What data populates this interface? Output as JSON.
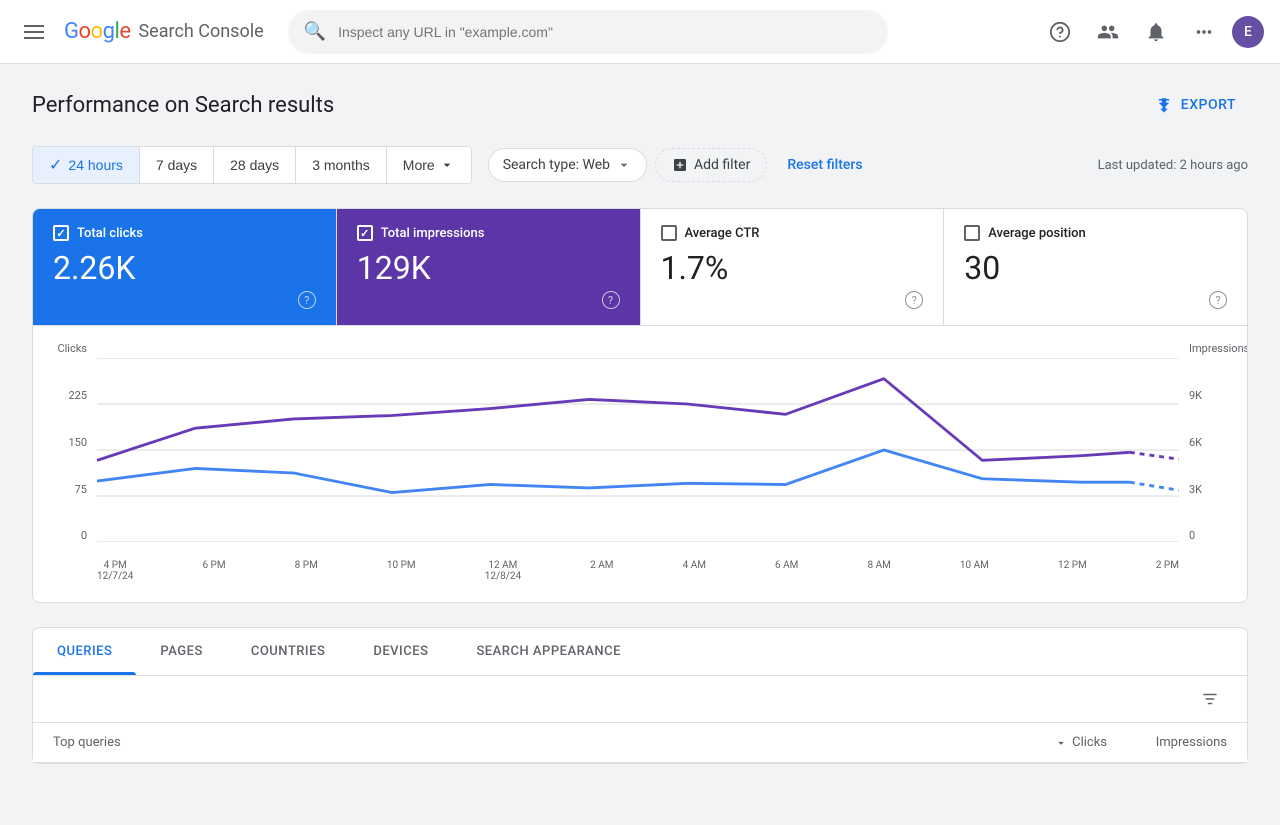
{
  "app": {
    "title": "Google Search Console",
    "logo_text": "Google",
    "product_name": "Search Console"
  },
  "nav": {
    "search_placeholder": "Inspect any URL in \"example.com\"",
    "avatar_letter": "E",
    "export_label": "EXPORT",
    "hamburger_label": "Menu"
  },
  "page": {
    "title": "Performance on Search results"
  },
  "filters": {
    "time_options": [
      {
        "label": "24 hours",
        "active": true
      },
      {
        "label": "7 days",
        "active": false
      },
      {
        "label": "28 days",
        "active": false
      },
      {
        "label": "3 months",
        "active": false
      },
      {
        "label": "More",
        "active": false
      }
    ],
    "search_type_label": "Search type: Web",
    "add_filter_label": "+ Add filter",
    "reset_label": "Reset filters",
    "last_updated": "Last updated: 2 hours ago"
  },
  "metrics": [
    {
      "id": "total-clicks",
      "label": "Total clicks",
      "value": "2.26K",
      "checked": true,
      "active_style": "blue"
    },
    {
      "id": "total-impressions",
      "label": "Total impressions",
      "value": "129K",
      "checked": true,
      "active_style": "purple"
    },
    {
      "id": "average-ctr",
      "label": "Average CTR",
      "value": "1.7%",
      "checked": false,
      "active_style": "none"
    },
    {
      "id": "average-position",
      "label": "Average position",
      "value": "30",
      "checked": false,
      "active_style": "none"
    }
  ],
  "chart": {
    "y_axis_left_label": "Clicks",
    "y_axis_right_label": "Impressions",
    "y_left_values": [
      "225",
      "150",
      "75",
      "0"
    ],
    "y_right_values": [
      "9K",
      "6K",
      "3K",
      "0"
    ],
    "x_labels": [
      {
        "line1": "4 PM",
        "line2": "12/7/24"
      },
      {
        "line1": "6 PM",
        "line2": ""
      },
      {
        "line1": "8 PM",
        "line2": ""
      },
      {
        "line1": "10 PM",
        "line2": ""
      },
      {
        "line1": "12 AM",
        "line2": "12/8/24"
      },
      {
        "line1": "2 AM",
        "line2": ""
      },
      {
        "line1": "4 AM",
        "line2": ""
      },
      {
        "line1": "6 AM",
        "line2": ""
      },
      {
        "line1": "8 AM",
        "line2": ""
      },
      {
        "line1": "10 AM",
        "line2": ""
      },
      {
        "line1": "12 PM",
        "line2": ""
      },
      {
        "line1": "2 PM",
        "line2": ""
      }
    ]
  },
  "table": {
    "tabs": [
      {
        "label": "QUERIES",
        "active": true
      },
      {
        "label": "PAGES",
        "active": false
      },
      {
        "label": "COUNTRIES",
        "active": false
      },
      {
        "label": "DEVICES",
        "active": false
      },
      {
        "label": "SEARCH APPEARANCE",
        "active": false
      }
    ],
    "header": {
      "query_col": "Top queries",
      "clicks_col": "Clicks",
      "impressions_col": "Impressions"
    }
  }
}
